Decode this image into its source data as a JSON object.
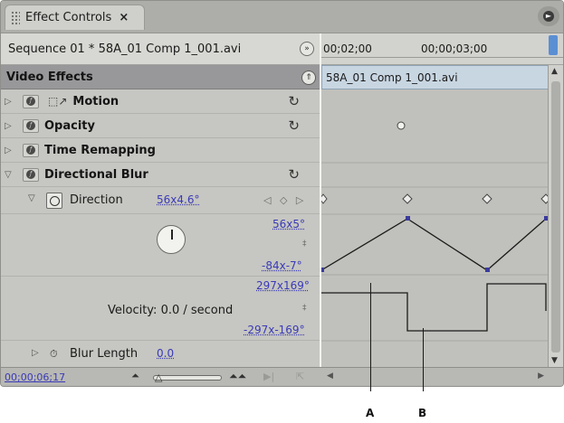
{
  "panel": {
    "tab_label": "Effect Controls",
    "tab_close": "×",
    "panel_menu_icon": "►"
  },
  "sequence": {
    "name": "Sequence 01 * 58A_01 Comp 1_001.avi",
    "collapse_glyph": "»"
  },
  "video_effects": {
    "label": "Video Effects",
    "collapse_glyph": "⇑"
  },
  "effects": [
    {
      "name": "Motion",
      "expanded": false,
      "has_reset": true
    },
    {
      "name": "Opacity",
      "expanded": false,
      "has_reset": true
    },
    {
      "name": "Time Remapping",
      "expanded": false,
      "has_reset": false
    },
    {
      "name": "Directional Blur",
      "expanded": true,
      "has_reset": true
    }
  ],
  "direction": {
    "label": "Direction",
    "value": "56x4.6°",
    "keyframe_nav": "◁ ◇ ▷",
    "graph_max": "56x5°",
    "graph_min": "-84x-7°",
    "velocity_max": "297x169°",
    "velocity_min": "-297x-169°",
    "velocity_label": "Velocity: 0.0 / second",
    "range_sep": "‡"
  },
  "blur_length": {
    "label": "Blur Length",
    "value": "0.0"
  },
  "footer": {
    "timecode": "00;00;06;17"
  },
  "timeline": {
    "ticks": [
      "00;02;00",
      "00;00;03;00"
    ],
    "clip_name": "58A_01 Comp 1_001.avi"
  },
  "callouts": [
    "A",
    "B"
  ],
  "colors": {
    "value_link": "#3a3ab8",
    "clip_bar": "#c8d6e2",
    "playhead": "#5b8fd3",
    "keyframe_point": "#3b3b9c"
  }
}
